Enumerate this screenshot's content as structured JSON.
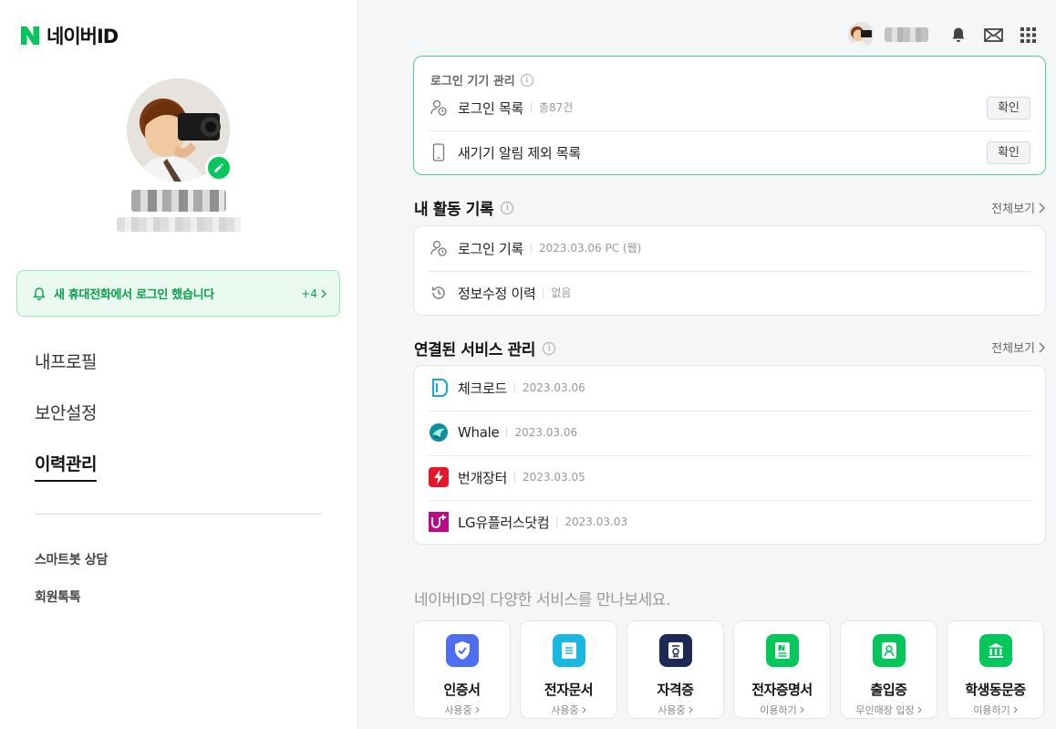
{
  "brand": {
    "logo_text": "네이버ID",
    "green": "#03c75a"
  },
  "notice": {
    "text": "새 휴대전화에서 로그인 했습니다",
    "count": "+4"
  },
  "nav": {
    "items": [
      {
        "label": "내프로필"
      },
      {
        "label": "보안설정"
      },
      {
        "label": "이력관리",
        "active": true
      }
    ],
    "sub_items": [
      {
        "label": "스마트봇 상담"
      },
      {
        "label": "회원톡톡"
      }
    ]
  },
  "topbar": {
    "icons": [
      "bell-icon",
      "mail-icon",
      "grid-menu-icon"
    ]
  },
  "device_mgmt": {
    "title": "로그인 기기 관리",
    "rows": [
      {
        "label": "로그인 목록",
        "meta": "총87건",
        "button": "확인"
      },
      {
        "label": "새기기 알림 제외 목록",
        "button": "확인"
      }
    ]
  },
  "activity": {
    "title": "내 활동 기록",
    "more": "전체보기",
    "rows": [
      {
        "label": "로그인 기록",
        "meta": "2023.03.06 PC (웹)"
      },
      {
        "label": "정보수정 이력",
        "meta": "없음"
      }
    ]
  },
  "services": {
    "title": "연결된 서비스 관리",
    "more": "전체보기",
    "rows": [
      {
        "label": "체크로드",
        "date": "2023.03.06",
        "icon": "checkroad-logo"
      },
      {
        "label": "Whale",
        "date": "2023.03.06",
        "icon": "whale-logo"
      },
      {
        "label": "번개장터",
        "date": "2023.03.05",
        "icon": "bunjang-logo"
      },
      {
        "label": "LG유플러스닷컴",
        "date": "2023.03.03",
        "icon": "lguplus-logo"
      }
    ]
  },
  "promo": {
    "text": "네이버ID의 다양한 서비스를 만나보세요."
  },
  "tiles": [
    {
      "name": "인증서",
      "sub": "사용중",
      "color": "#4e6ef2"
    },
    {
      "name": "전자문서",
      "sub": "사용중",
      "color": "#18b8e0"
    },
    {
      "name": "자격증",
      "sub": "사용중",
      "color": "#1c2a55"
    },
    {
      "name": "전자증명서",
      "sub": "이용하기",
      "color": "#03c75a"
    },
    {
      "name": "출입증",
      "sub": "무인매장 입장",
      "color": "#03c75a"
    },
    {
      "name": "학생동문증",
      "sub": "이용하기",
      "color": "#03c75a"
    }
  ]
}
